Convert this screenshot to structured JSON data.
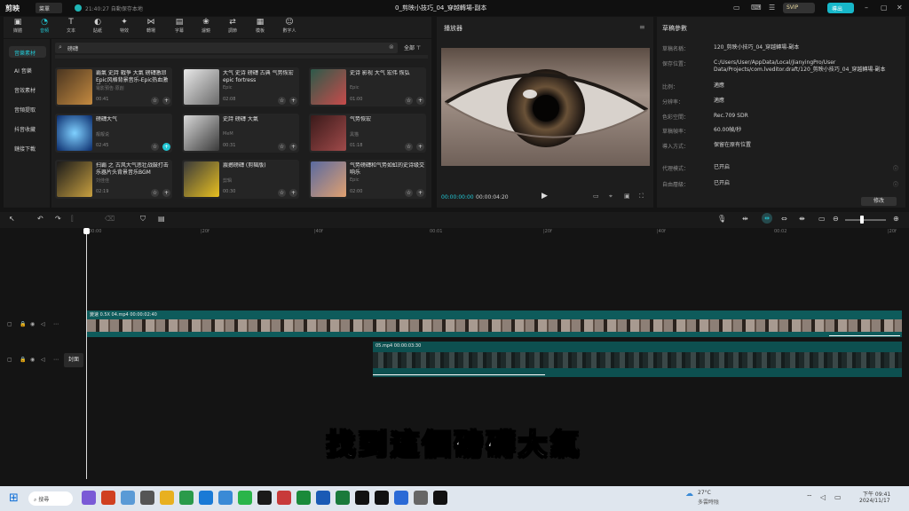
{
  "titlebar": {
    "logo": "剪映",
    "menu": "菜單",
    "save_status": "21:40:27 自動保存本地",
    "title": "0_剪映小技巧_04_穿越轉場-副本",
    "svip": "SVIP",
    "export": "導出"
  },
  "top_tools": [
    "媒體",
    "音頻",
    "文本",
    "貼紙",
    "特效",
    "轉場",
    "字幕",
    "濾鏡",
    "調節",
    "模板",
    "數字人"
  ],
  "left_nav": [
    "音樂素材",
    "AI 音樂",
    "音效素材",
    "音頻提取",
    "抖音收藏",
    "鏈接下載"
  ],
  "search": {
    "placeholder": "磅礴",
    "filter": "全部"
  },
  "music_cards": [
    {
      "title": "霸氣 史詩 戰爭 大氣 磅礴激昂 Epic风格背景音乐-Epic热血激昂-出征",
      "sub": "電影預告·原創",
      "dur": "00:41"
    },
    {
      "title": "大气 史诗 磅礴 古典 气势恢宏 epic fortress",
      "sub": "Epic",
      "dur": "02:08"
    },
    {
      "title": "史诗 影视 大气 宏伟 恢弘",
      "sub": "Epic",
      "dur": "01:00"
    },
    {
      "title": "磅礴大气",
      "sub": "靓靓说",
      "dur": "02:45"
    },
    {
      "title": "史詩 磅礴 大氣",
      "sub": "MeM",
      "dur": "00:31"
    },
    {
      "title": "气势恢宏",
      "sub": "黑猫",
      "dur": "01:18"
    },
    {
      "title": "扫霸 之 古风大气悲壮战鼓打击乐器片头背景音乐BGM",
      "sub": "刘佳佳",
      "dur": "02:19"
    },
    {
      "title": "震撼磅礴 (剪辑版)",
      "sub": "剪辑",
      "dur": "00:30"
    },
    {
      "title": "气势磅礴和气势如虹的史诗级交响乐",
      "sub": "Epic",
      "dur": "02:00"
    }
  ],
  "player": {
    "title": "播放器",
    "time_current": "00:00:00:00",
    "time_total": "00:00:04:20"
  },
  "properties": {
    "title": "草稿參數",
    "rows": [
      {
        "k": "草稿名稱：",
        "v": "120_剪映小技巧_04_穿越轉場-副本"
      },
      {
        "k": "保存位置：",
        "v": "C:/Users/User/AppData/Local/JianyingPro/User Data/Projects/com.lveditor.draft/120_剪映小技巧_04_穿越轉場-副本"
      },
      {
        "k": "比例：",
        "v": "適應"
      },
      {
        "k": "分辨率：",
        "v": "適應"
      },
      {
        "k": "色彩空間：",
        "v": "Rec.709 SDR"
      },
      {
        "k": "草稿幀率：",
        "v": "60.00幀/秒"
      },
      {
        "k": "導入方式：",
        "v": "保留在原有位置"
      },
      {
        "k": "代理模式：",
        "v": "已开启"
      },
      {
        "k": "自由層級：",
        "v": "已开启"
      }
    ],
    "edit_button": "修改"
  },
  "timeline": {
    "ruler": [
      "00:00",
      "|20f",
      "|40f",
      "00:01",
      "|20f",
      "|40f",
      "00:02",
      "|20f"
    ],
    "clip_main_label": "變速 0.5X  04.mp4  00:00:02:40",
    "clip_sec_label": "05.mp4  00:00:03:30",
    "cover": "封面"
  },
  "subtitle": "找到這個磅礴大氣",
  "taskbar": {
    "search": "搜尋",
    "weather_temp": "27°C",
    "weather_desc": "多雲時陰",
    "time": "下午 09:41",
    "date": "2024/11/17"
  },
  "colors": {
    "accent": "#22c7d4",
    "clip": "#0e5b5b",
    "background": "#141414"
  }
}
